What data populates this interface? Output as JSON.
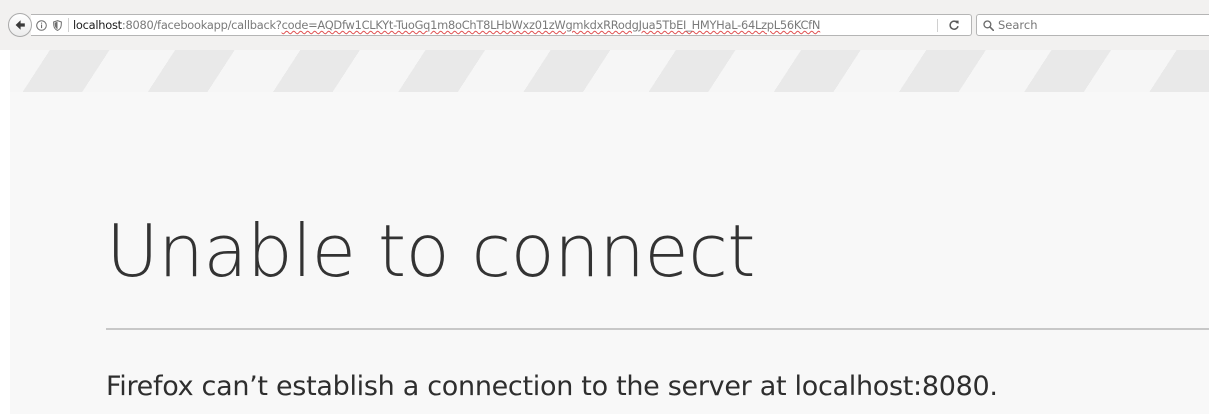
{
  "browser": {
    "url_host": "localhost",
    "url_rest": ":8080/facebookapp/callback?",
    "url_code": "code=AQDfw1CLKYt-TuoGq1m8oChT8LHbWxz01zWgmkdxRRodgJua5TbEI_HMYHaL-64LzpL56KCfN",
    "search_placeholder": "Search",
    "icons": {
      "back": "back-arrow-icon",
      "info": "info-icon",
      "tracking": "shield-icon",
      "reload": "reload-icon",
      "search": "search-icon"
    }
  },
  "error_page": {
    "title": "Unable to connect",
    "description": "Firefox can’t establish a connection to the server at localhost:8080."
  },
  "colors": {
    "page_background": "#f8f8f8",
    "title_text": "#333333",
    "divider": "#c8c8c8"
  }
}
